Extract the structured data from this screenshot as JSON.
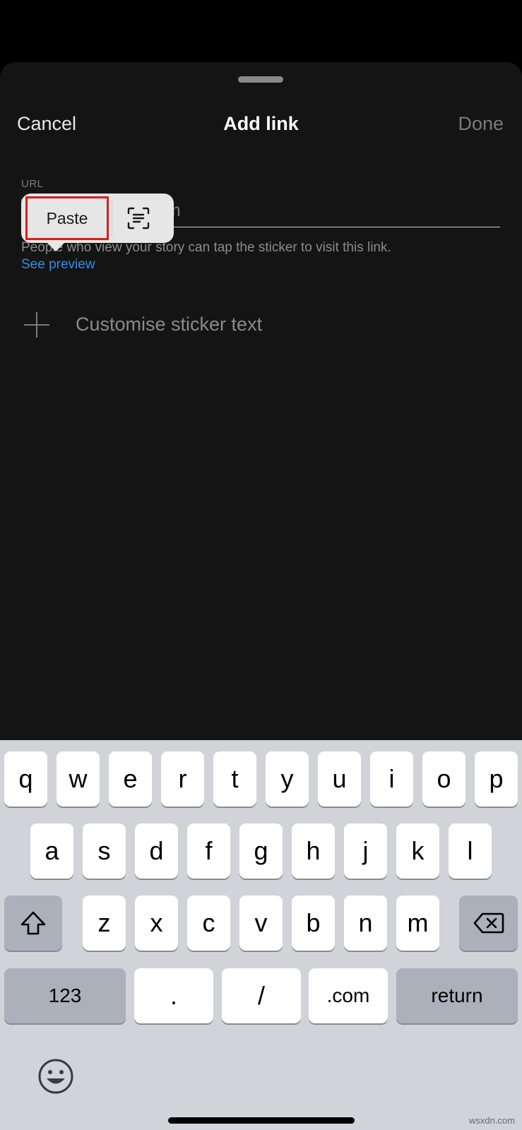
{
  "nav": {
    "cancel": "Cancel",
    "title": "Add link",
    "done": "Done"
  },
  "url": {
    "label": "URL",
    "placeholder": "https://example.com",
    "helper": "People who view your story can tap the sticker to visit this link.",
    "preview": "See preview"
  },
  "customise": {
    "label": "Customise sticker text",
    "icon": "plus-icon"
  },
  "context_menu": {
    "paste": "Paste",
    "scan_icon": "scan-text-icon"
  },
  "keyboard": {
    "row1": [
      "q",
      "w",
      "e",
      "r",
      "t",
      "y",
      "u",
      "i",
      "o",
      "p"
    ],
    "row2": [
      "a",
      "s",
      "d",
      "f",
      "g",
      "h",
      "j",
      "k",
      "l"
    ],
    "row3": [
      "z",
      "x",
      "c",
      "v",
      "b",
      "n",
      "m"
    ],
    "row4": {
      "numbers": "123",
      "dot": ".",
      "slash": "/",
      "dotcom": ".com",
      "return": "return"
    },
    "icons": {
      "shift": "shift-icon",
      "delete": "delete-icon",
      "emoji": "emoji-icon"
    }
  },
  "watermark": "wsxdn.com",
  "colors": {
    "link": "#2f8fe6",
    "highlight": "#d81e1e",
    "caret": "#5b5bf0"
  }
}
